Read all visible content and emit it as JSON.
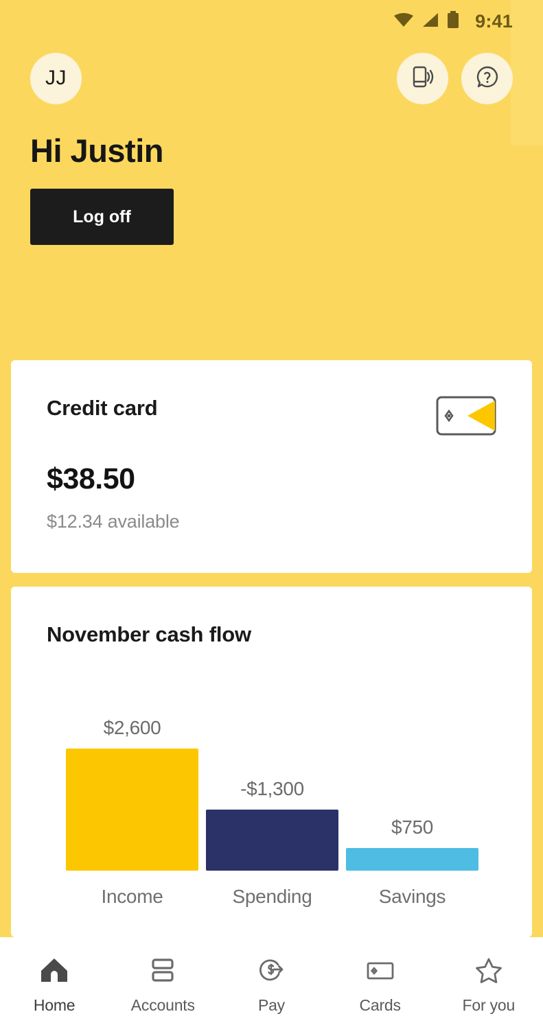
{
  "status_bar": {
    "time": "9:41",
    "icons": [
      "wifi-icon",
      "cellular-signal-icon",
      "battery-icon"
    ]
  },
  "header": {
    "avatar_initials": "JJ",
    "greeting": "Hi Justin",
    "logoff_label": "Log off",
    "action_icons": [
      "tap-to-pay-icon",
      "help-icon"
    ],
    "background_color": "#FBD85D"
  },
  "credit_card": {
    "title": "Credit card",
    "balance": "$38.50",
    "available": "$12.34 available",
    "icon": "credit-card-icon"
  },
  "cash_flow": {
    "title": "November cash flow"
  },
  "chart_data": {
    "type": "bar",
    "title": "November cash flow",
    "categories": [
      "Income",
      "Spending",
      "Savings"
    ],
    "values": [
      2600,
      -1300,
      750
    ],
    "value_labels": [
      "$2,600",
      "-$1,300",
      "$750"
    ],
    "colors": [
      "#FCC700",
      "#2B3268",
      "#4FBCE4"
    ],
    "xlabel": "",
    "ylabel": "",
    "ylim": [
      0,
      2600
    ],
    "grid": false,
    "legend": "none"
  },
  "bottom_nav": {
    "items": [
      {
        "label": "Home",
        "icon": "home-icon",
        "active": true
      },
      {
        "label": "Accounts",
        "icon": "accounts-icon",
        "active": false
      },
      {
        "label": "Pay",
        "icon": "pay-icon",
        "active": false
      },
      {
        "label": "Cards",
        "icon": "cards-icon",
        "active": false
      },
      {
        "label": "For you",
        "icon": "star-icon",
        "active": false
      }
    ]
  }
}
